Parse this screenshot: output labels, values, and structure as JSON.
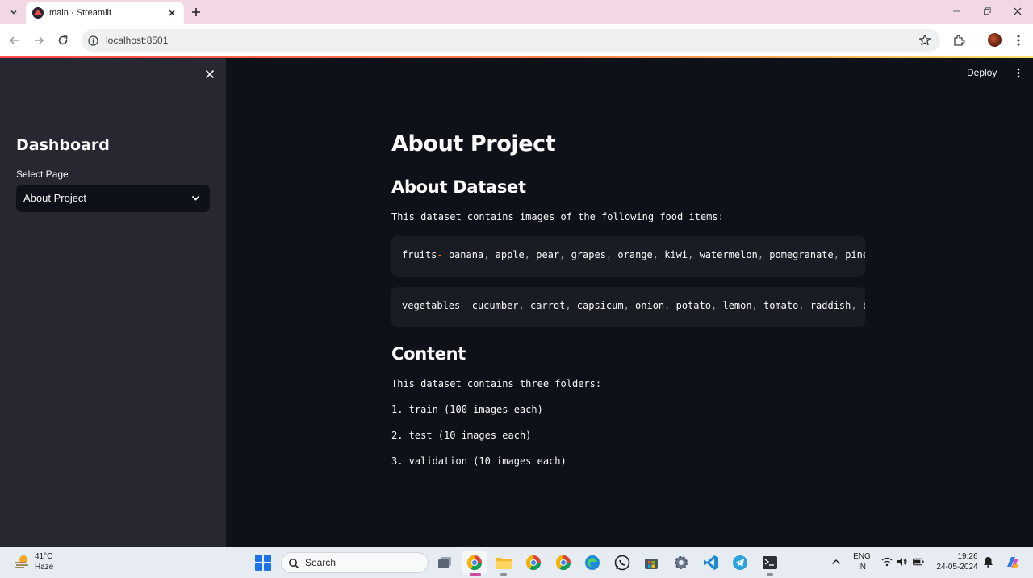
{
  "browser": {
    "tab_title": "main · Streamlit",
    "url": "localhost:8501",
    "icons": [
      "tab-list-icon",
      "streamlit-favicon-icon",
      "close-tab-icon",
      "new-tab-icon",
      "minimize-icon",
      "restore-icon",
      "close-window-icon",
      "back-icon",
      "forward-icon",
      "reload-icon",
      "site-info-icon",
      "bookmark-star-icon",
      "extensions-icon",
      "profile-avatar",
      "browser-menu-icon"
    ]
  },
  "sidebar": {
    "title": "Dashboard",
    "select_label": "Select Page",
    "select_value": "About Project"
  },
  "header": {
    "deploy_label": "Deploy"
  },
  "main": {
    "title": "About Project",
    "dataset_heading": "About Dataset",
    "dataset_intro": "This dataset contains images of the following food items:",
    "fruits_label": "fruits",
    "fruits": [
      "banana",
      "apple",
      "pear",
      "grapes",
      "orange",
      "kiwi",
      "watermelon",
      "pomegranate",
      "pineap"
    ],
    "vegetables_label": "vegetables",
    "vegetables": [
      "cucumber",
      "carrot",
      "capsicum",
      "onion",
      "potato",
      "lemon",
      "tomato",
      "raddish",
      "bee"
    ],
    "content_heading": "Content",
    "content_intro": "This dataset contains three folders:",
    "folders": [
      "1. train (100 images each)",
      "2. test (10 images each)",
      "3. validation (10 images each)"
    ]
  },
  "taskbar": {
    "temperature": "41°C",
    "weather": "Haze",
    "search_label": "Search",
    "language_line1": "ENG",
    "language_line2": "IN",
    "time": "19:26",
    "date": "24-05-2024"
  },
  "colors": {
    "app_background": "#0e1117",
    "sidebar_background": "#262730",
    "code_background": "#1a1c24",
    "code_operator": "#f76b15",
    "tabbar": "#f1d8e4"
  }
}
